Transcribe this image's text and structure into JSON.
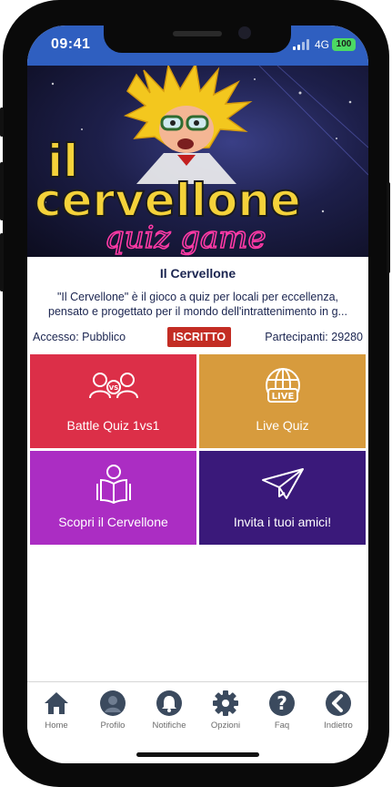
{
  "status_bar": {
    "time": "09:41",
    "network": "4G",
    "battery": "100"
  },
  "banner": {
    "logo_line1": "il",
    "logo_line2": "cervellone",
    "logo_line3": "quiz game"
  },
  "game": {
    "title": "Il Cervellone",
    "description_line1": "\"Il Cervellone\" è il gioco a quiz per locali per eccellenza,",
    "description_line2": "pensato e progettato per il mondo dell'intrattenimento in g...",
    "access": "Accesso: Pubblico",
    "status_badge": "ISCRITTO",
    "participants": "Partecipanti: 29280"
  },
  "tiles": [
    {
      "label": "Battle Quiz 1vs1",
      "icon": "versus-users-icon",
      "color": "#dc2f48"
    },
    {
      "label": "Live Quiz",
      "icon": "live-globe-icon",
      "color": "#d79b3d"
    },
    {
      "label": "Scopri il Cervellone",
      "icon": "reader-icon",
      "color": "#ab2dc3"
    },
    {
      "label": "Invita i tuoi amici!",
      "icon": "paper-plane-icon",
      "color": "#3a197a"
    }
  ],
  "tabbar": [
    {
      "label": "Home",
      "icon": "home-icon"
    },
    {
      "label": "Profilo",
      "icon": "user-icon"
    },
    {
      "label": "Notifiche",
      "icon": "bell-icon"
    },
    {
      "label": "Opzioni",
      "icon": "gear-icon"
    },
    {
      "label": "Faq",
      "icon": "question-icon"
    },
    {
      "label": "Indietro",
      "icon": "back-icon"
    }
  ]
}
